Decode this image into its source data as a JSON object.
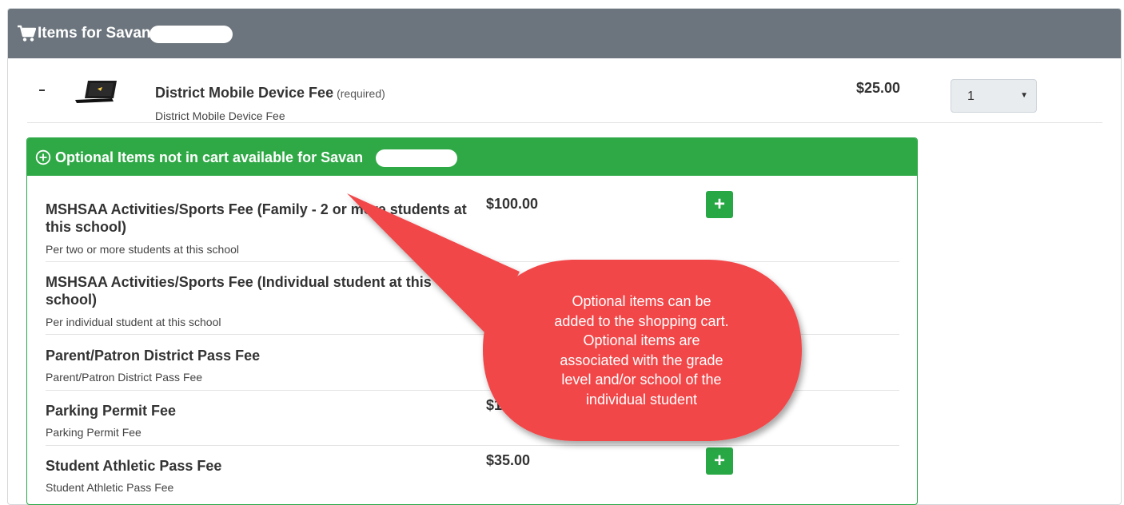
{
  "header": {
    "title": "Items for Savan",
    "icon": "shopping-cart-icon"
  },
  "cart_item": {
    "name": "District Mobile Device Fee",
    "required_label": "(required)",
    "description": "District Mobile Device Fee",
    "price": "$25.00",
    "quantity": "1"
  },
  "optional": {
    "title": "Optional Items not in cart available for Savan",
    "icon": "plus-circle-icon",
    "items": [
      {
        "name": "MSHSAA Activities/Sports Fee (Family - 2 or more students at this school)",
        "description": "Per two or more students at this school",
        "price": "$100.00",
        "add_label": "+"
      },
      {
        "name": "MSHSAA Activities/Sports Fee (Individual student at this school)",
        "description": "Per individual student at this school",
        "price": "$",
        "add_label": "+"
      },
      {
        "name": "Parent/Patron District Pass Fee",
        "description": "Parent/Patron District Pass Fee",
        "price": "",
        "add_label": "+"
      },
      {
        "name": "Parking Permit Fee",
        "description": "Parking Permit Fee",
        "price": "$1",
        "add_label": "+"
      },
      {
        "name": "Student Athletic Pass Fee",
        "description": "Student Athletic Pass Fee",
        "price": "$35.00",
        "add_label": "+"
      }
    ]
  },
  "callout": {
    "lines": [
      "Optional items can be",
      "added to the shopping cart.",
      "Optional items are",
      "associated with the grade",
      "level and/or school of the",
      "individual student"
    ],
    "color": "#f2464a"
  }
}
